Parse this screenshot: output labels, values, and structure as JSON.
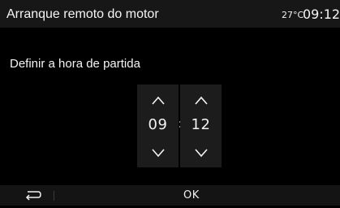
{
  "header": {
    "title": "Arranque remoto do motor",
    "temperature": "27°C",
    "clock": "09:12"
  },
  "main": {
    "instruction": "Definir a hora de partida",
    "time_picker": {
      "hours": "09",
      "separator": ":",
      "minutes": "12"
    }
  },
  "footer": {
    "back_icon": "back-arrow-icon",
    "ok_label": "OK"
  },
  "colors": {
    "background": "#000000",
    "header_bg": "#171717",
    "picker_bg": "#1c1c1c",
    "footer_bg": "#141414",
    "text": "#f2f2f2"
  }
}
